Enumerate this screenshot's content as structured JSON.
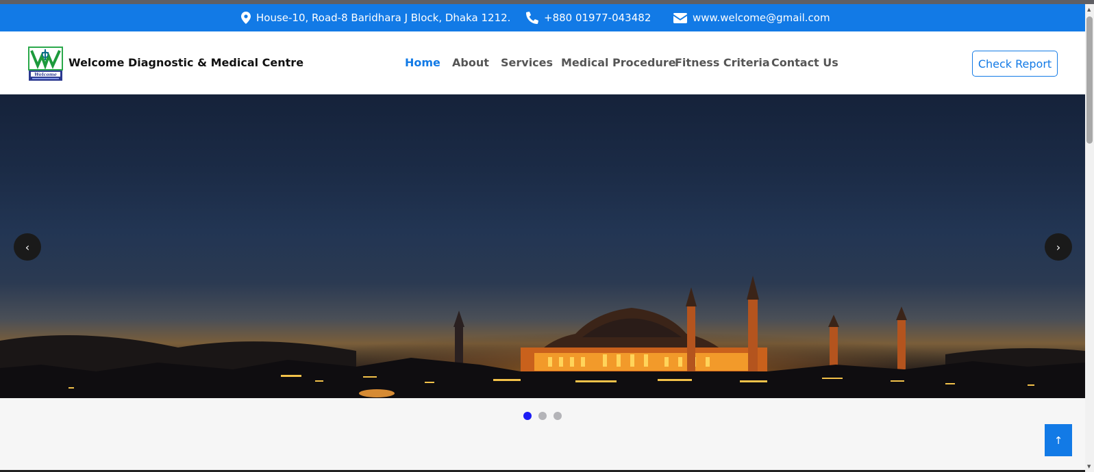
{
  "topbar": {
    "address": "House-10, Road-8 Baridhara J Block, Dhaka 1212.",
    "phone": "+880 01977-043482",
    "email": "www.welcome@gmail.com",
    "address_icon": "map-marker-icon",
    "phone_icon": "phone-icon",
    "email_icon": "envelope-icon"
  },
  "brand": {
    "name": "Welcome Diagnostic & Medical Centre",
    "logo_text": "Welcome"
  },
  "nav": {
    "items": [
      {
        "label": "Home",
        "active": true
      },
      {
        "label": "About"
      },
      {
        "label": "Services"
      },
      {
        "label": "Medical Procedure"
      },
      {
        "label": "Fitness Criteria"
      },
      {
        "label": "Contact Us"
      }
    ],
    "cta_label": "Check Report"
  },
  "carousel": {
    "prev_label": "‹",
    "next_label": "›",
    "slide_count": 3,
    "active_slide": 1
  },
  "back_to_top_label": "↑",
  "colors": {
    "primary": "#127ae6",
    "active_dot": "#1d1df5"
  }
}
